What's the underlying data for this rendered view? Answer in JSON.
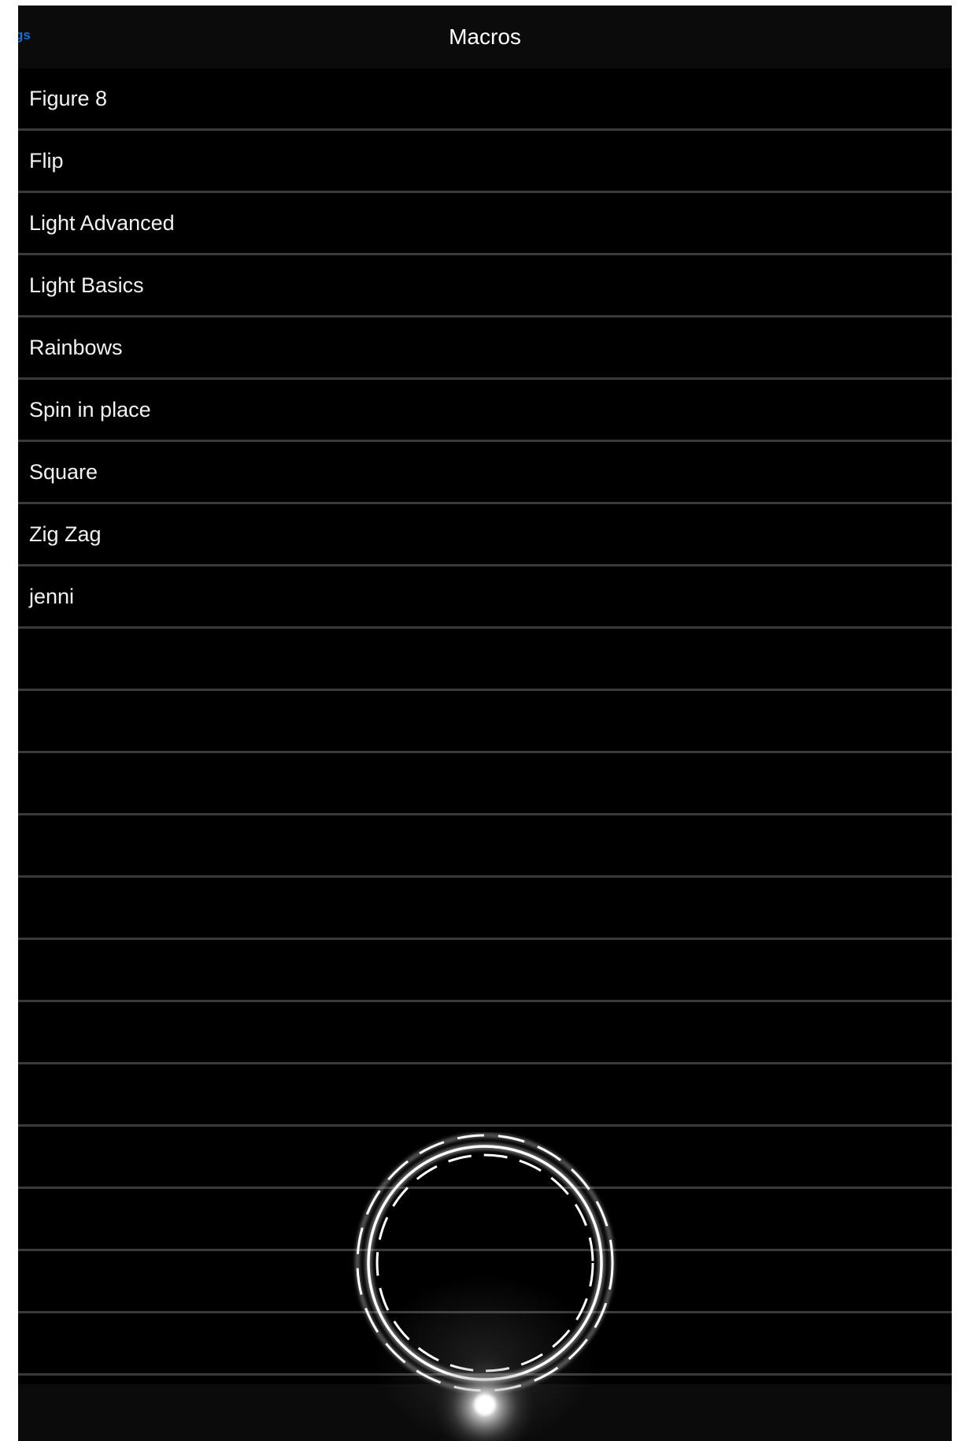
{
  "navbar": {
    "back_label": "gs",
    "title": "Macros"
  },
  "macros": [
    "Figure 8",
    "Flip",
    "Light Advanced",
    "Light Basics",
    "Rainbows",
    "Spin in place",
    "Square",
    "Zig Zag",
    "jenni"
  ],
  "colors": {
    "background": "#000000",
    "text": "#f2f2f2",
    "separator": "#3a3a3a",
    "link": "#1a6fd8"
  },
  "icons": {
    "drive_control": "joystick-ring-icon"
  }
}
